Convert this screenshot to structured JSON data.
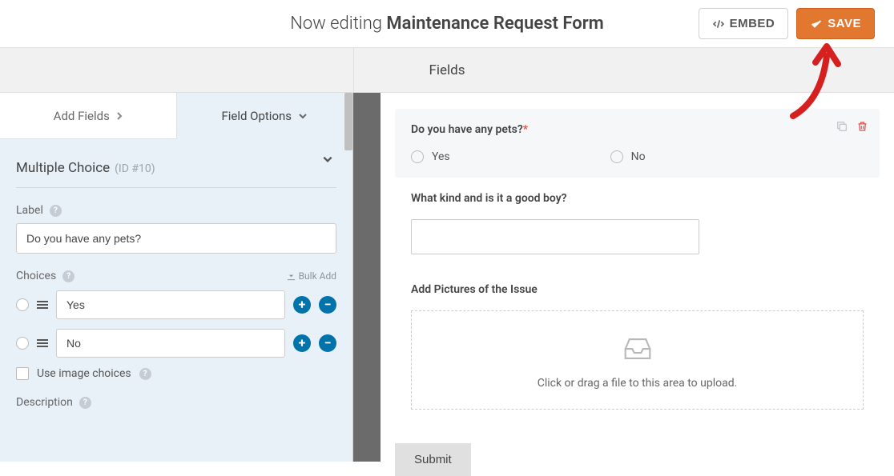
{
  "header": {
    "editingPrefix": "Now editing ",
    "formName": "Maintenance Request Form",
    "embedLabel": "EMBED",
    "saveLabel": "SAVE"
  },
  "tabs": {
    "centerLabel": "Fields"
  },
  "sidebar": {
    "tabs": {
      "addFields": "Add Fields",
      "fieldOptions": "Field Options"
    },
    "panel": {
      "fieldType": "Multiple Choice",
      "fieldId": "(ID #10)",
      "labelLabel": "Label",
      "labelValue": "Do you have any pets?",
      "choicesLabel": "Choices",
      "bulkAdd": "Bulk Add",
      "choices": [
        "Yes",
        "No"
      ],
      "imageChoices": "Use image choices",
      "descriptionLabel": "Description"
    }
  },
  "form": {
    "q1": {
      "label": "Do you have any pets?",
      "required": "*",
      "options": [
        "Yes",
        "No"
      ]
    },
    "q2": {
      "label": "What kind and is it a good boy?"
    },
    "q3": {
      "label": "Add Pictures of the Issue",
      "uploadMsg": "Click or drag a file to this area to upload."
    },
    "submitLabel": "Submit"
  }
}
